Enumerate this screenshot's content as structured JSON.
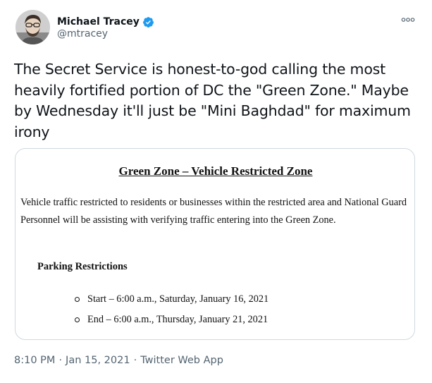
{
  "tweet": {
    "author": {
      "display_name": "Michael Tracey",
      "handle": "@mtracey",
      "verified": true,
      "avatar_icon": "avatar-photo"
    },
    "more_icon": "more-horizontal-icon",
    "text": "The Secret Service is honest-to-god calling the most heavily fortified portion of DC the \"Green Zone.\" Maybe by Wednesday it'll just be \"Mini Baghdad\" for maximum irony",
    "media": {
      "title": "Green Zone – Vehicle Restricted Zone",
      "body": "Vehicle traffic restricted to residents or businesses within the restricted area and National Guard Personnel will be assisting with verifying traffic entering into the Green Zone.",
      "subheading": "Parking Restrictions",
      "items": [
        "Start – 6:00 a.m., Saturday, January 16, 2021",
        "End – 6:00 a.m., Thursday, January 21, 2021"
      ]
    },
    "meta": {
      "time": "8:10 PM",
      "separator": "·",
      "date": "Jan 15, 2021",
      "source": "Twitter Web App"
    }
  },
  "colors": {
    "text_primary": "#0f1419",
    "text_secondary": "#536471",
    "verified_blue": "#1d9bf0",
    "card_border": "#cfd9de"
  }
}
